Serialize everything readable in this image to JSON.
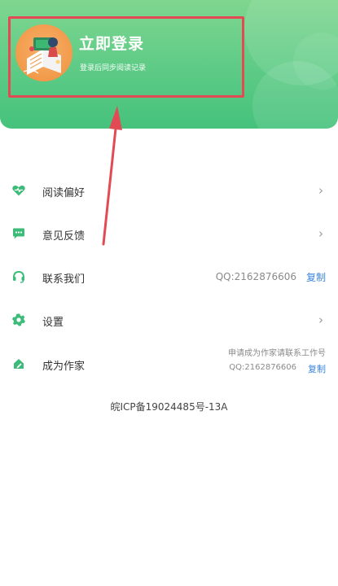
{
  "header": {
    "login_title": "立即登录",
    "login_subtitle": "登录后同步阅读记录"
  },
  "menu": {
    "reading_preference": {
      "label": "阅读偏好",
      "chevron": "›"
    },
    "feedback": {
      "label": "意见反馈",
      "chevron": "›"
    },
    "contact": {
      "label": "联系我们",
      "qq": "QQ:2162876606",
      "copy": "复制"
    },
    "settings": {
      "label": "设置",
      "chevron": "›"
    },
    "become_writer": {
      "label": "成为作家",
      "note": "申请成为作家请联系工作号",
      "qq": "QQ:2162876606",
      "copy": "复制"
    }
  },
  "footer": {
    "icp": "皖ICP备19024485号-13A"
  },
  "colors": {
    "header_green": "#5dcb86",
    "icon_green": "#3dbb79",
    "highlight_red": "#e24b53",
    "link_blue": "#3b86e0"
  },
  "icons": [
    "heart-icon",
    "chat-icon",
    "headset-icon",
    "gear-icon",
    "pen-icon"
  ]
}
